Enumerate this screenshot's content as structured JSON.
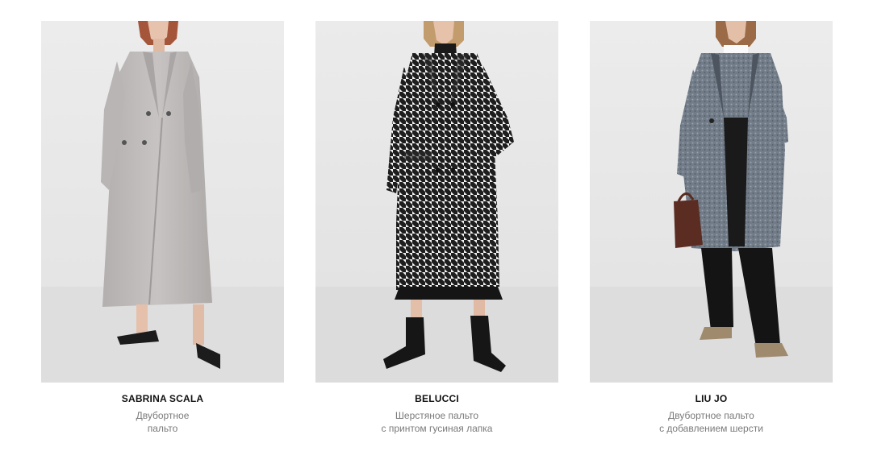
{
  "products": [
    {
      "brand": "SABRINA SCALA",
      "description_line1": "Двубортное",
      "description_line2": "пальто",
      "image": "grey-long-double-breasted-coat-photo",
      "coat_color": "#c2bfbe",
      "background_color": "#e9e9e9"
    },
    {
      "brand": "BELUCCI",
      "description_line1": "Шерстяное пальто",
      "description_line2": "с принтом гусиная лапка",
      "image": "houndstooth-wool-coat-photo",
      "coat_color": "#5a5a5a",
      "background_color": "#e7e7e7"
    },
    {
      "brand": "LIU JO",
      "description_line1": "Двубортное пальто",
      "description_line2": "с добавлением шерсти",
      "image": "grey-blue-tweed-coat-photo",
      "coat_color": "#6e7884",
      "background_color": "#e8e8e8"
    }
  ]
}
